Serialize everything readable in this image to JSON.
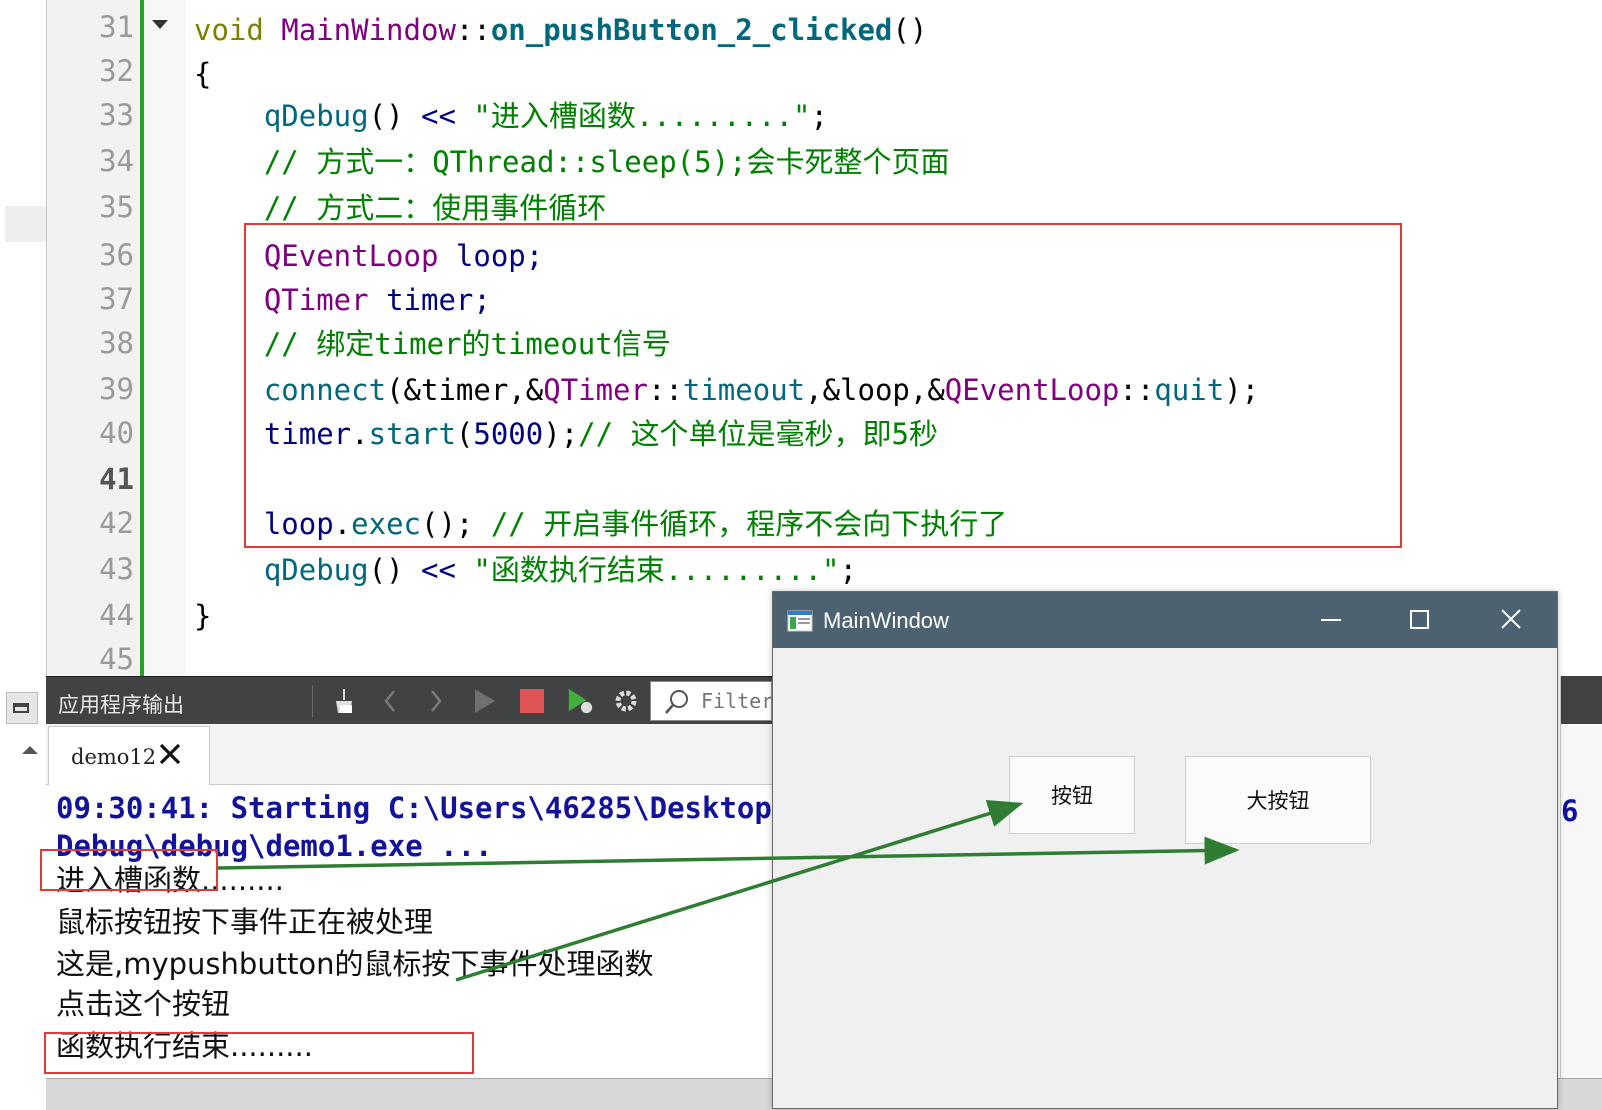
{
  "editor": {
    "line_numbers": [
      "31",
      "32",
      "33",
      "34",
      "35",
      "36",
      "37",
      "38",
      "39",
      "40",
      "41",
      "42",
      "43",
      "44",
      "45"
    ],
    "current_line": "41",
    "lines": {
      "l31": {
        "a": "void",
        "b": " MainWindow",
        "c": "::",
        "d": "on_pushButton_2_clicked",
        "e": "()"
      },
      "l32": {
        "a": "{"
      },
      "l33": {
        "a": "    qDebug",
        "b": "()",
        "c": " << ",
        "d": "\"进入槽函数.........\"",
        "e": ";"
      },
      "l34": {
        "a": "    // 方式一：QThread::sleep(5);会卡死整个页面"
      },
      "l35": {
        "a": "    // 方式二：使用事件循环"
      },
      "l36": {
        "a": "    QEventLoop",
        "b": " loop;"
      },
      "l37": {
        "a": "    QTimer",
        "b": " timer;"
      },
      "l38": {
        "a": "    // 绑定timer的timeout信号"
      },
      "l39": {
        "a": "    connect",
        "b": "(&timer,&",
        "c": "QTimer",
        "d": "::",
        "e": "timeout",
        "f": ",&loop,&",
        "g": "QEventLoop",
        "h": "::",
        "i": "quit",
        "j": ");"
      },
      "l40": {
        "a": "    timer",
        "b": ".",
        "c": "start",
        "d": "(",
        "e": "5000",
        "f": ");",
        "g": "// 这个单位是毫秒，即5秒"
      },
      "l42": {
        "a": "    loop",
        "b": ".",
        "c": "exec",
        "d": "();",
        "e": " // 开启事件循环，程序不会向下执行了"
      },
      "l43": {
        "a": "    qDebug",
        "b": "()",
        "c": " << ",
        "d": "\"函数执行结束.........\"",
        "e": ";"
      },
      "l44": {
        "a": "}"
      }
    }
  },
  "output_pane": {
    "title": "应用程序输出",
    "filter_placeholder": "Filter",
    "tab_label": "demo12",
    "lines": [
      "09:30:41: Starting C:\\Users\\46285\\Desktop\\",
      "Debug\\debug\\demo1.exe ...",
      "进入槽函数.........",
      "鼠标按钮按下事件正在被处理",
      "这是,mypushbutton的鼠标按下事件处理函数",
      "点击这个按钮",
      "函数执行结束........."
    ],
    "overflow_fragment": "6"
  },
  "main_window": {
    "title": "MainWindow",
    "button1_label": "按钮",
    "button2_label": "大按钮"
  },
  "colors": {
    "highlight": "#e53935",
    "arrow": "#2e7d32",
    "titlebar": "#4c6270"
  }
}
